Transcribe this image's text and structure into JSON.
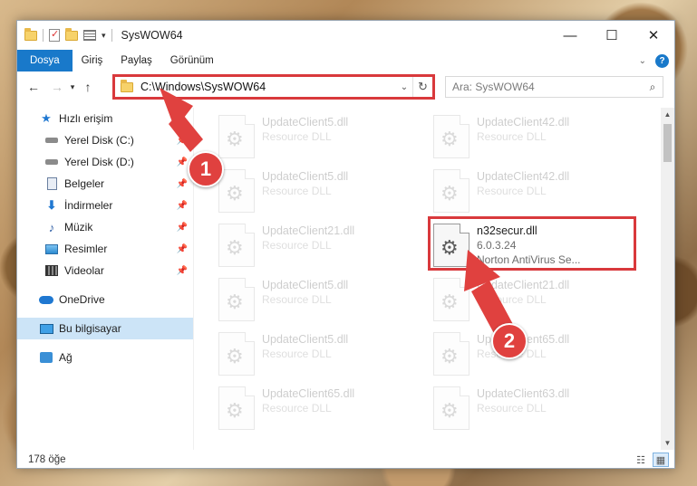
{
  "window": {
    "title": "SysWOW64",
    "controls": {
      "minimize": "—",
      "maximize": "☐",
      "close": "✕"
    }
  },
  "ribbon": {
    "tabs": [
      "Dosya",
      "Giriş",
      "Paylaş",
      "Görünüm"
    ]
  },
  "navbar": {
    "address": "C:\\Windows\\SysWOW64",
    "search_placeholder": "Ara: SysWOW64"
  },
  "sidebar": {
    "items": [
      {
        "label": "Hızlı erişim",
        "icon": "star-icon",
        "pinned": false
      },
      {
        "label": "Yerel Disk (C:)",
        "icon": "drive-icon",
        "pinned": true
      },
      {
        "label": "Yerel Disk (D:)",
        "icon": "drive-icon",
        "pinned": true
      },
      {
        "label": "Belgeler",
        "icon": "documents-icon",
        "pinned": true
      },
      {
        "label": "İndirmeler",
        "icon": "downloads-icon",
        "pinned": true
      },
      {
        "label": "Müzik",
        "icon": "music-icon",
        "pinned": true
      },
      {
        "label": "Resimler",
        "icon": "pictures-icon",
        "pinned": true
      },
      {
        "label": "Videolar",
        "icon": "videos-icon",
        "pinned": true
      },
      {
        "label": "OneDrive",
        "icon": "onedrive-icon",
        "pinned": false
      },
      {
        "label": "Bu bilgisayar",
        "icon": "computer-icon",
        "pinned": false,
        "selected": true
      },
      {
        "label": "Ağ",
        "icon": "network-icon",
        "pinned": false
      }
    ]
  },
  "files": {
    "left": [
      {
        "name": "UpdateClient5.dll",
        "type": "Resource DLL"
      },
      {
        "name": "UpdateClient5.dll",
        "type": "Resource DLL"
      },
      {
        "name": "UpdateClient21.dll",
        "type": "Resource DLL"
      },
      {
        "name": "UpdateClient5.dll",
        "type": "Resource DLL"
      },
      {
        "name": "UpdateClient5.dll",
        "type": "Resource DLL"
      },
      {
        "name": "UpdateClient65.dll",
        "type": "Resource DLL"
      }
    ],
    "right": [
      {
        "name": "UpdateClient42.dll",
        "type": "Resource DLL"
      },
      {
        "name": "UpdateClient42.dll",
        "type": "Resource DLL"
      },
      {
        "name": "n32secur.dll",
        "version": "6.0.3.24",
        "description": "Norton AntiVirus Se...",
        "highlight": true
      },
      {
        "name": "UpdateClient21.dll",
        "type": "Resource DLL"
      },
      {
        "name": "UpdateClient65.dll",
        "type": "Resource DLL"
      },
      {
        "name": "UpdateClient63.dll",
        "type": "Resource DLL"
      }
    ]
  },
  "status": {
    "item_count": "178 öğe"
  },
  "annotations": {
    "step1": "1",
    "step2": "2",
    "color": "#e0413f"
  }
}
